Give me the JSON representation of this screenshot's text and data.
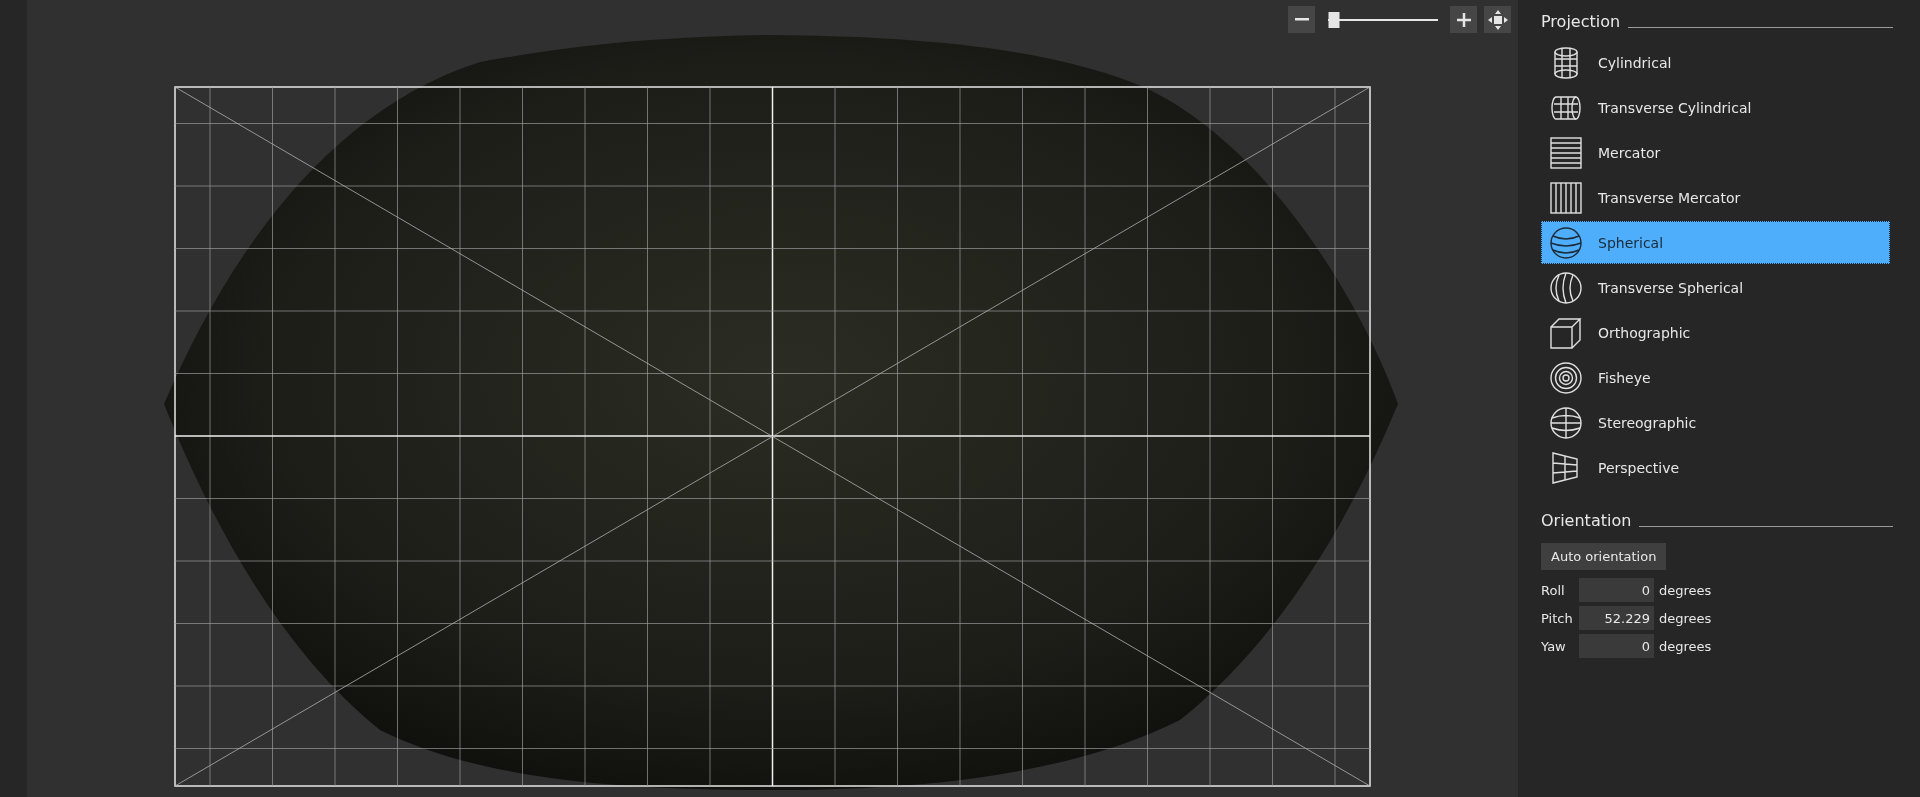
{
  "zoom": {
    "level": 0.05
  },
  "projection": {
    "title": "Projection",
    "items": [
      {
        "label": "Cylindrical",
        "kind": "cylindrical",
        "selected": false
      },
      {
        "label": "Transverse Cylindrical",
        "kind": "transverse-cylindrical",
        "selected": false
      },
      {
        "label": "Mercator",
        "kind": "mercator",
        "selected": false
      },
      {
        "label": "Transverse Mercator",
        "kind": "transverse-mercator",
        "selected": false
      },
      {
        "label": "Spherical",
        "kind": "spherical",
        "selected": true
      },
      {
        "label": "Transverse Spherical",
        "kind": "transverse-spherical",
        "selected": false
      },
      {
        "label": "Orthographic",
        "kind": "orthographic",
        "selected": false
      },
      {
        "label": "Fisheye",
        "kind": "fisheye",
        "selected": false
      },
      {
        "label": "Stereographic",
        "kind": "stereographic",
        "selected": false
      },
      {
        "label": "Perspective",
        "kind": "perspective",
        "selected": false
      }
    ]
  },
  "orientation": {
    "title": "Orientation",
    "button": "Auto orientation",
    "fields": [
      {
        "label": "Roll",
        "value": "0",
        "unit": "degrees"
      },
      {
        "label": "Pitch",
        "value": "52.229",
        "unit": "degrees"
      },
      {
        "label": "Yaw",
        "value": "0",
        "unit": "degrees"
      }
    ]
  }
}
